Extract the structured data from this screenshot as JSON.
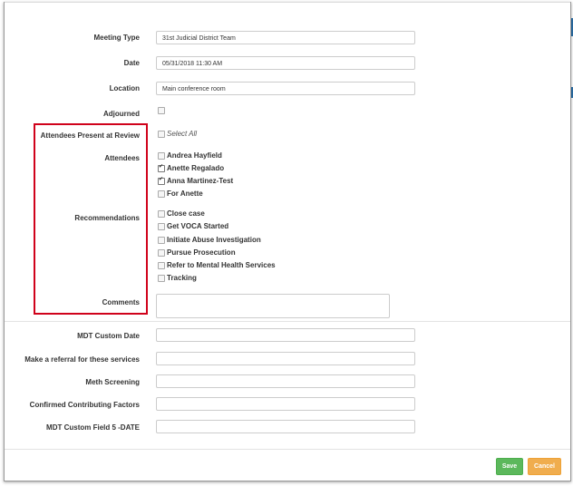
{
  "form": {
    "meeting_type": {
      "label": "Meeting Type",
      "value": "31st Judicial District Team"
    },
    "date": {
      "label": "Date",
      "value": "05/31/2018 11:30 AM"
    },
    "location": {
      "label": "Location",
      "value": "Main conference room"
    },
    "adjourned": {
      "label": "Adjourned"
    },
    "attendees_present": {
      "label": "Attendees Present at Review",
      "select_all": "Select All"
    },
    "attendees": {
      "label": "Attendees",
      "options": [
        {
          "label": "Andrea Hayfield",
          "checked": false
        },
        {
          "label": "Anette Regalado",
          "checked": true
        },
        {
          "label": "Anna Martinez-Test",
          "checked": true
        },
        {
          "label": "For Anette",
          "checked": false
        }
      ]
    },
    "recommendations": {
      "label": "Recommendations",
      "options": [
        {
          "label": "Close case",
          "checked": false
        },
        {
          "label": "Get VOCA Started",
          "checked": false
        },
        {
          "label": "Initiate Abuse Investigation",
          "checked": false
        },
        {
          "label": "Pursue Prosecution",
          "checked": false
        },
        {
          "label": "Refer to Mental Health Services",
          "checked": false
        },
        {
          "label": "Tracking",
          "checked": false
        }
      ]
    },
    "comments": {
      "label": "Comments",
      "value": ""
    },
    "mdt_custom_date": {
      "label": "MDT Custom Date",
      "value": ""
    },
    "referral_services": {
      "label": "Make a referral for these services",
      "value": ""
    },
    "meth_screening": {
      "label": "Meth Screening",
      "value": ""
    },
    "confirmed_factors": {
      "label": "Confirmed Contributing Factors",
      "value": ""
    },
    "mdt_custom_field5": {
      "label": "MDT Custom Field 5 -DATE",
      "value": ""
    }
  },
  "footer": {
    "save_label": "Save",
    "cancel_label": "Cancel"
  },
  "colors": {
    "save": "#5cb85c",
    "cancel": "#f0ad4e",
    "highlight": "#d0021b"
  }
}
